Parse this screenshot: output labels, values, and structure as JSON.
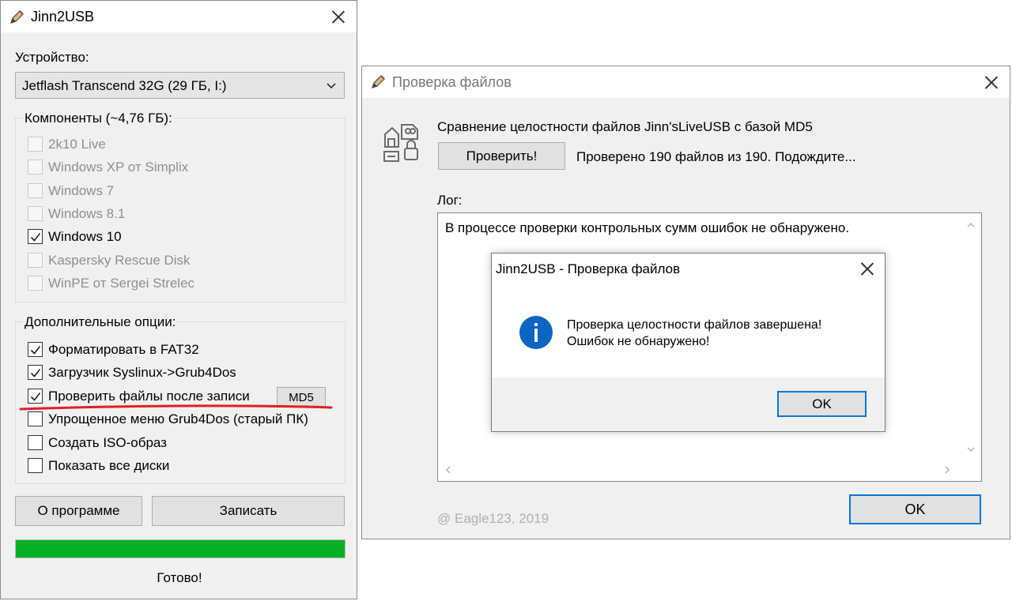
{
  "main_window": {
    "title": "Jinn2USB",
    "device_label": "Устройство:",
    "device_value": "Jetflash Transcend 32G (29 ГБ, I:)",
    "components_title": "Компоненты (~4,76 ГБ):",
    "components": [
      {
        "label": "2k10 Live",
        "checked": false,
        "disabled": true
      },
      {
        "label": "Windows XP от Simplix",
        "checked": false,
        "disabled": true
      },
      {
        "label": "Windows 7",
        "checked": false,
        "disabled": true
      },
      {
        "label": "Windows 8.1",
        "checked": false,
        "disabled": true
      },
      {
        "label": "Windows 10",
        "checked": true,
        "disabled": false
      },
      {
        "label": "Kaspersky Rescue Disk",
        "checked": false,
        "disabled": true
      },
      {
        "label": "WinPE от Sergei Strelec",
        "checked": false,
        "disabled": true
      }
    ],
    "options_title": "Дополнительные опции:",
    "options": [
      {
        "label": "Форматировать в FAT32",
        "checked": true
      },
      {
        "label": "Загрузчик Syslinux->Grub4Dos",
        "checked": true
      },
      {
        "label": "Проверить файлы после записи",
        "checked": true
      },
      {
        "label": "Упрощенное меню Grub4Dos (старый ПК)",
        "checked": false
      },
      {
        "label": "Создать ISO-образ",
        "checked": false
      },
      {
        "label": "Показать все диски",
        "checked": false
      }
    ],
    "md5_button": "MD5",
    "about_button": "О программе",
    "write_button": "Записать",
    "progress": 1.0,
    "status": "Готово!"
  },
  "verify_window": {
    "title": "Проверка файлов",
    "heading": "Сравнение целостности файлов Jinn'sLiveUSB с базой MD5",
    "check_button": "Проверить!",
    "progress_text": "Проверено 190 файлов из 190. Подождите...",
    "log_label": "Лог:",
    "log_text": "В процессе проверки контрольных сумм ошибок не обнаружено.",
    "copyright": "@ Eagle123, 2019",
    "ok_button": "OK"
  },
  "message_box": {
    "title": "Jinn2USB - Проверка файлов",
    "line1": "Проверка целостности файлов завершена!",
    "line2": "Ошибок не обнаружено!",
    "ok_button": "OK"
  },
  "colors": {
    "progress_fill": "#06b025",
    "accent": "#0078d7",
    "annotation_underline": "#e02020",
    "info_icon": "#0a64c2"
  }
}
